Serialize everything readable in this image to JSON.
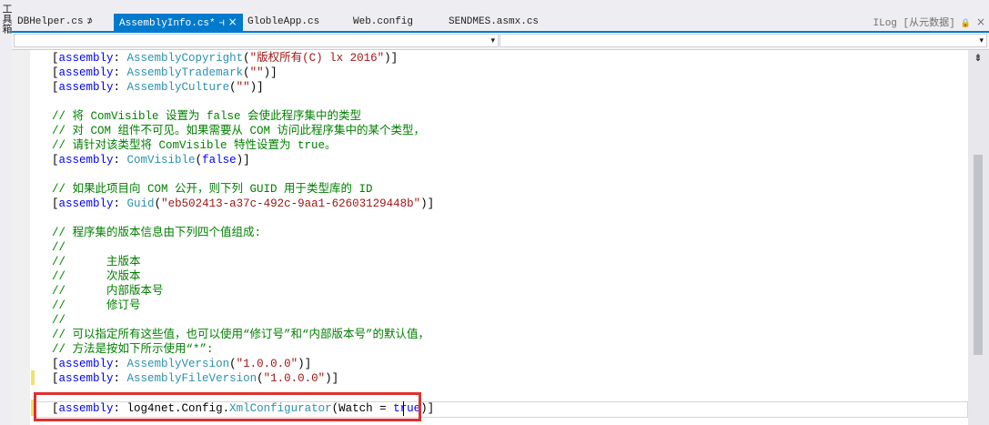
{
  "side": {
    "label": "工具箱"
  },
  "tabs": [
    {
      "label": "DBHelper.cs",
      "pin": "⊅"
    },
    {
      "label": "AssemblyInfo.cs*",
      "pin": "⊣",
      "close": "×"
    },
    {
      "label": "GlobleApp.cs"
    },
    {
      "label": "Web.config"
    },
    {
      "label": "SENDMES.asmx.cs"
    }
  ],
  "right_tab": {
    "label": "ILog [从元数据]",
    "lock": "🔒",
    "close": "×"
  },
  "colors": {
    "accent": "#007acc",
    "keyword": "#0000ff",
    "type": "#2b91af",
    "string": "#a31515",
    "comment": "#008000",
    "highlight_box": "#e03030"
  },
  "code": {
    "l1": {
      "a": "[",
      "b": "assembly",
      "c": ": ",
      "d": "AssemblyCopyright",
      "e": "(",
      "f": "\"版权所有(C) lx 2016\"",
      "g": ")]"
    },
    "l2": {
      "a": "[",
      "b": "assembly",
      "c": ": ",
      "d": "AssemblyTrademark",
      "e": "(",
      "f": "\"\"",
      "g": ")]"
    },
    "l3": {
      "a": "[",
      "b": "assembly",
      "c": ": ",
      "d": "AssemblyCulture",
      "e": "(",
      "f": "\"\"",
      "g": ")]"
    },
    "l5": "// 将 ComVisible 设置为 false 会使此程序集中的类型",
    "l6": "// 对 COM 组件不可见。如果需要从 COM 访问此程序集中的某个类型，",
    "l7": "// 请针对该类型将 ComVisible 特性设置为 true。",
    "l8": {
      "a": "[",
      "b": "assembly",
      "c": ": ",
      "d": "ComVisible",
      "e": "(",
      "f": "false",
      "g": ")]"
    },
    "l10": "// 如果此项目向 COM 公开，则下列 GUID 用于类型库的 ID",
    "l11": {
      "a": "[",
      "b": "assembly",
      "c": ": ",
      "d": "Guid",
      "e": "(",
      "f": "\"eb502413-a37c-492c-9aa1-62603129448b\"",
      "g": ")]"
    },
    "l13": "// 程序集的版本信息由下列四个值组成:",
    "l14": "//",
    "l15": "//      主版本",
    "l16": "//      次版本",
    "l17": "//      内部版本号",
    "l18": "//      修订号",
    "l19": "//",
    "l20": "// 可以指定所有这些值，也可以使用“修订号”和“内部版本号”的默认值，",
    "l21": "// 方法是按如下所示使用“*”:",
    "l22": {
      "a": "[",
      "b": "assembly",
      "c": ": ",
      "d": "AssemblyVersion",
      "e": "(",
      "f": "\"1.0.0.0\"",
      "g": ")]"
    },
    "l23": {
      "a": "[",
      "b": "assembly",
      "c": ": ",
      "d": "AssemblyFileVersion",
      "e": "(",
      "f": "\"1.0.0.0\"",
      "g": ")]"
    },
    "l25": {
      "a": "[",
      "b": "assembly",
      "c": ": ",
      "d": "log4net.Config.",
      "e": "XmlConfigurator",
      "f": "(Watch = ",
      "g": "true",
      "h": ")]"
    }
  }
}
